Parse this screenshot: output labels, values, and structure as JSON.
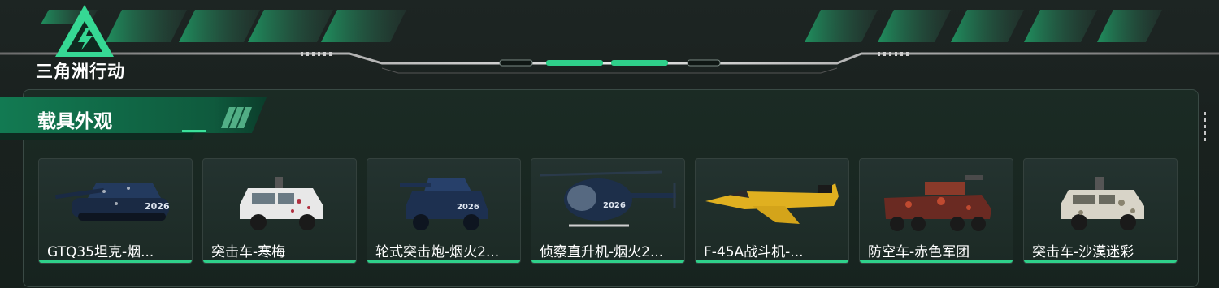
{
  "brand": {
    "logo_text": "三角洲行动",
    "accent": "#2fd08a"
  },
  "section": {
    "title": "载具外观"
  },
  "vehicles": [
    {
      "label": "GTQ35坦克-烟...",
      "icon": "tank"
    },
    {
      "label": "突击车-寒梅",
      "icon": "assault-vehicle"
    },
    {
      "label": "轮式突击炮-烟火2...",
      "icon": "wheeled-assault-gun"
    },
    {
      "label": "侦察直升机-烟火2...",
      "icon": "scout-helicopter"
    },
    {
      "label": "F-45A战斗机-...",
      "icon": "fighter-jet"
    },
    {
      "label": "防空车-赤色军团",
      "icon": "anti-air-vehicle"
    },
    {
      "label": "突击车-沙漠迷彩",
      "icon": "assault-vehicle"
    }
  ]
}
